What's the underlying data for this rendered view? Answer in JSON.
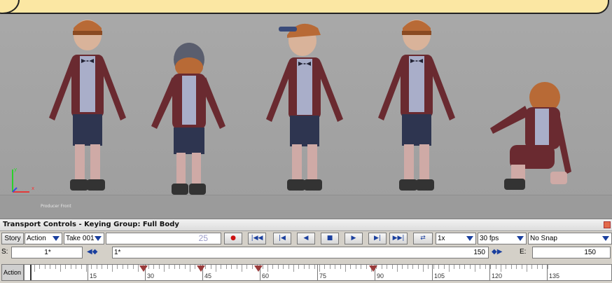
{
  "viewport": {
    "camera_label": "Producer Front",
    "axis": {
      "y": "y",
      "x": "x"
    }
  },
  "transport": {
    "title": "Transport Controls  -  Keying Group: Full Body",
    "mode_story": "Story",
    "mode_action": "Action",
    "take": "Take 001",
    "frame_display": "25",
    "speed": "1x",
    "fps": "30 fps",
    "snap": "No Snap",
    "start_label": "S:",
    "start_value": "1*",
    "current_value": "1*",
    "end_value_left": "150",
    "end_label": "E:",
    "end_value": "150",
    "track_label": "Action",
    "ruler_labels": [
      "15",
      "30",
      "45",
      "60",
      "75",
      "90",
      "105",
      "120",
      "135"
    ],
    "colors": {
      "accent": "#1a3f9e",
      "record": "#cc1111",
      "key": "#9a3b3b",
      "callout": "#fbe7a3"
    }
  }
}
